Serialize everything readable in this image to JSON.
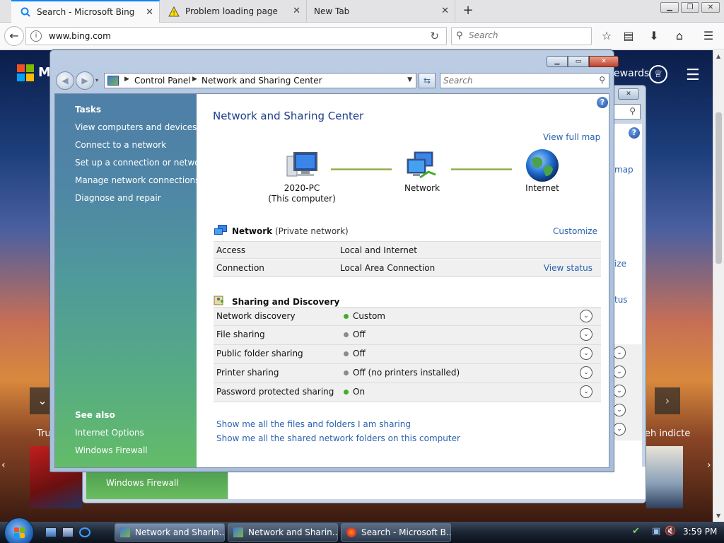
{
  "browser": {
    "tabs": [
      {
        "title": "Search - Microsoft Bing",
        "icon": "search-icon",
        "active": true
      },
      {
        "title": "Problem loading page",
        "icon": "warning-icon",
        "active": false
      },
      {
        "title": "New Tab",
        "icon": "",
        "active": false
      }
    ],
    "url": "www.bing.com",
    "search_placeholder": "Search"
  },
  "bing": {
    "logo_text": "M",
    "rewards_text": "ewards",
    "news_left": "Tru",
    "news_right": "eh indicte"
  },
  "window": {
    "breadcrumb": [
      "Control Panel",
      "Network and Sharing Center"
    ],
    "search_placeholder": "Search"
  },
  "taskpane": {
    "tasks_heading": "Tasks",
    "tasks": [
      "View computers and devices",
      "Connect to a network",
      "Set up a connection or network",
      "Manage network connections",
      "Diagnose and repair"
    ],
    "see_also_heading": "See also",
    "see_also": [
      "Internet Options",
      "Windows Firewall"
    ]
  },
  "content": {
    "title": "Network and Sharing Center",
    "view_full_map": "View full map",
    "map_nodes": [
      {
        "name": "2020-PC",
        "sub": "(This computer)",
        "icon": "computer-icon"
      },
      {
        "name": "Network",
        "sub": "",
        "icon": "network-icon"
      },
      {
        "name": "Internet",
        "sub": "",
        "icon": "globe-icon"
      }
    ],
    "network_section": {
      "name": "Network",
      "type": "(Private network)",
      "customize": "Customize",
      "rows": [
        {
          "label": "Access",
          "value": "Local and Internet",
          "link": ""
        },
        {
          "label": "Connection",
          "value": "Local Area Connection",
          "link": "View status"
        }
      ]
    },
    "sharing_section": {
      "title": "Sharing and Discovery",
      "rows": [
        {
          "label": "Network discovery",
          "value": "Custom",
          "status_color": "#3fae2a"
        },
        {
          "label": "File sharing",
          "value": "Off",
          "status_color": "#8a8a8a"
        },
        {
          "label": "Public folder sharing",
          "value": "Off",
          "status_color": "#8a8a8a"
        },
        {
          "label": "Printer sharing",
          "value": "Off (no printers installed)",
          "status_color": "#8a8a8a"
        },
        {
          "label": "Password protected sharing",
          "value": "On",
          "status_color": "#3fae2a"
        }
      ]
    },
    "bottom_links": [
      "Show me all the files and folders I am sharing",
      "Show me all the shared network folders on this computer"
    ]
  },
  "behind_window": {
    "links": [
      "map",
      "ize",
      "tus"
    ],
    "panel_link": "Windows Firewall"
  },
  "taskbar": {
    "buttons": [
      {
        "label": "Network and Sharin...",
        "active": true
      },
      {
        "label": "Network and Sharin...",
        "active": false
      },
      {
        "label": "Search - Microsoft B...",
        "active": false
      }
    ],
    "clock": "3:59 PM"
  }
}
